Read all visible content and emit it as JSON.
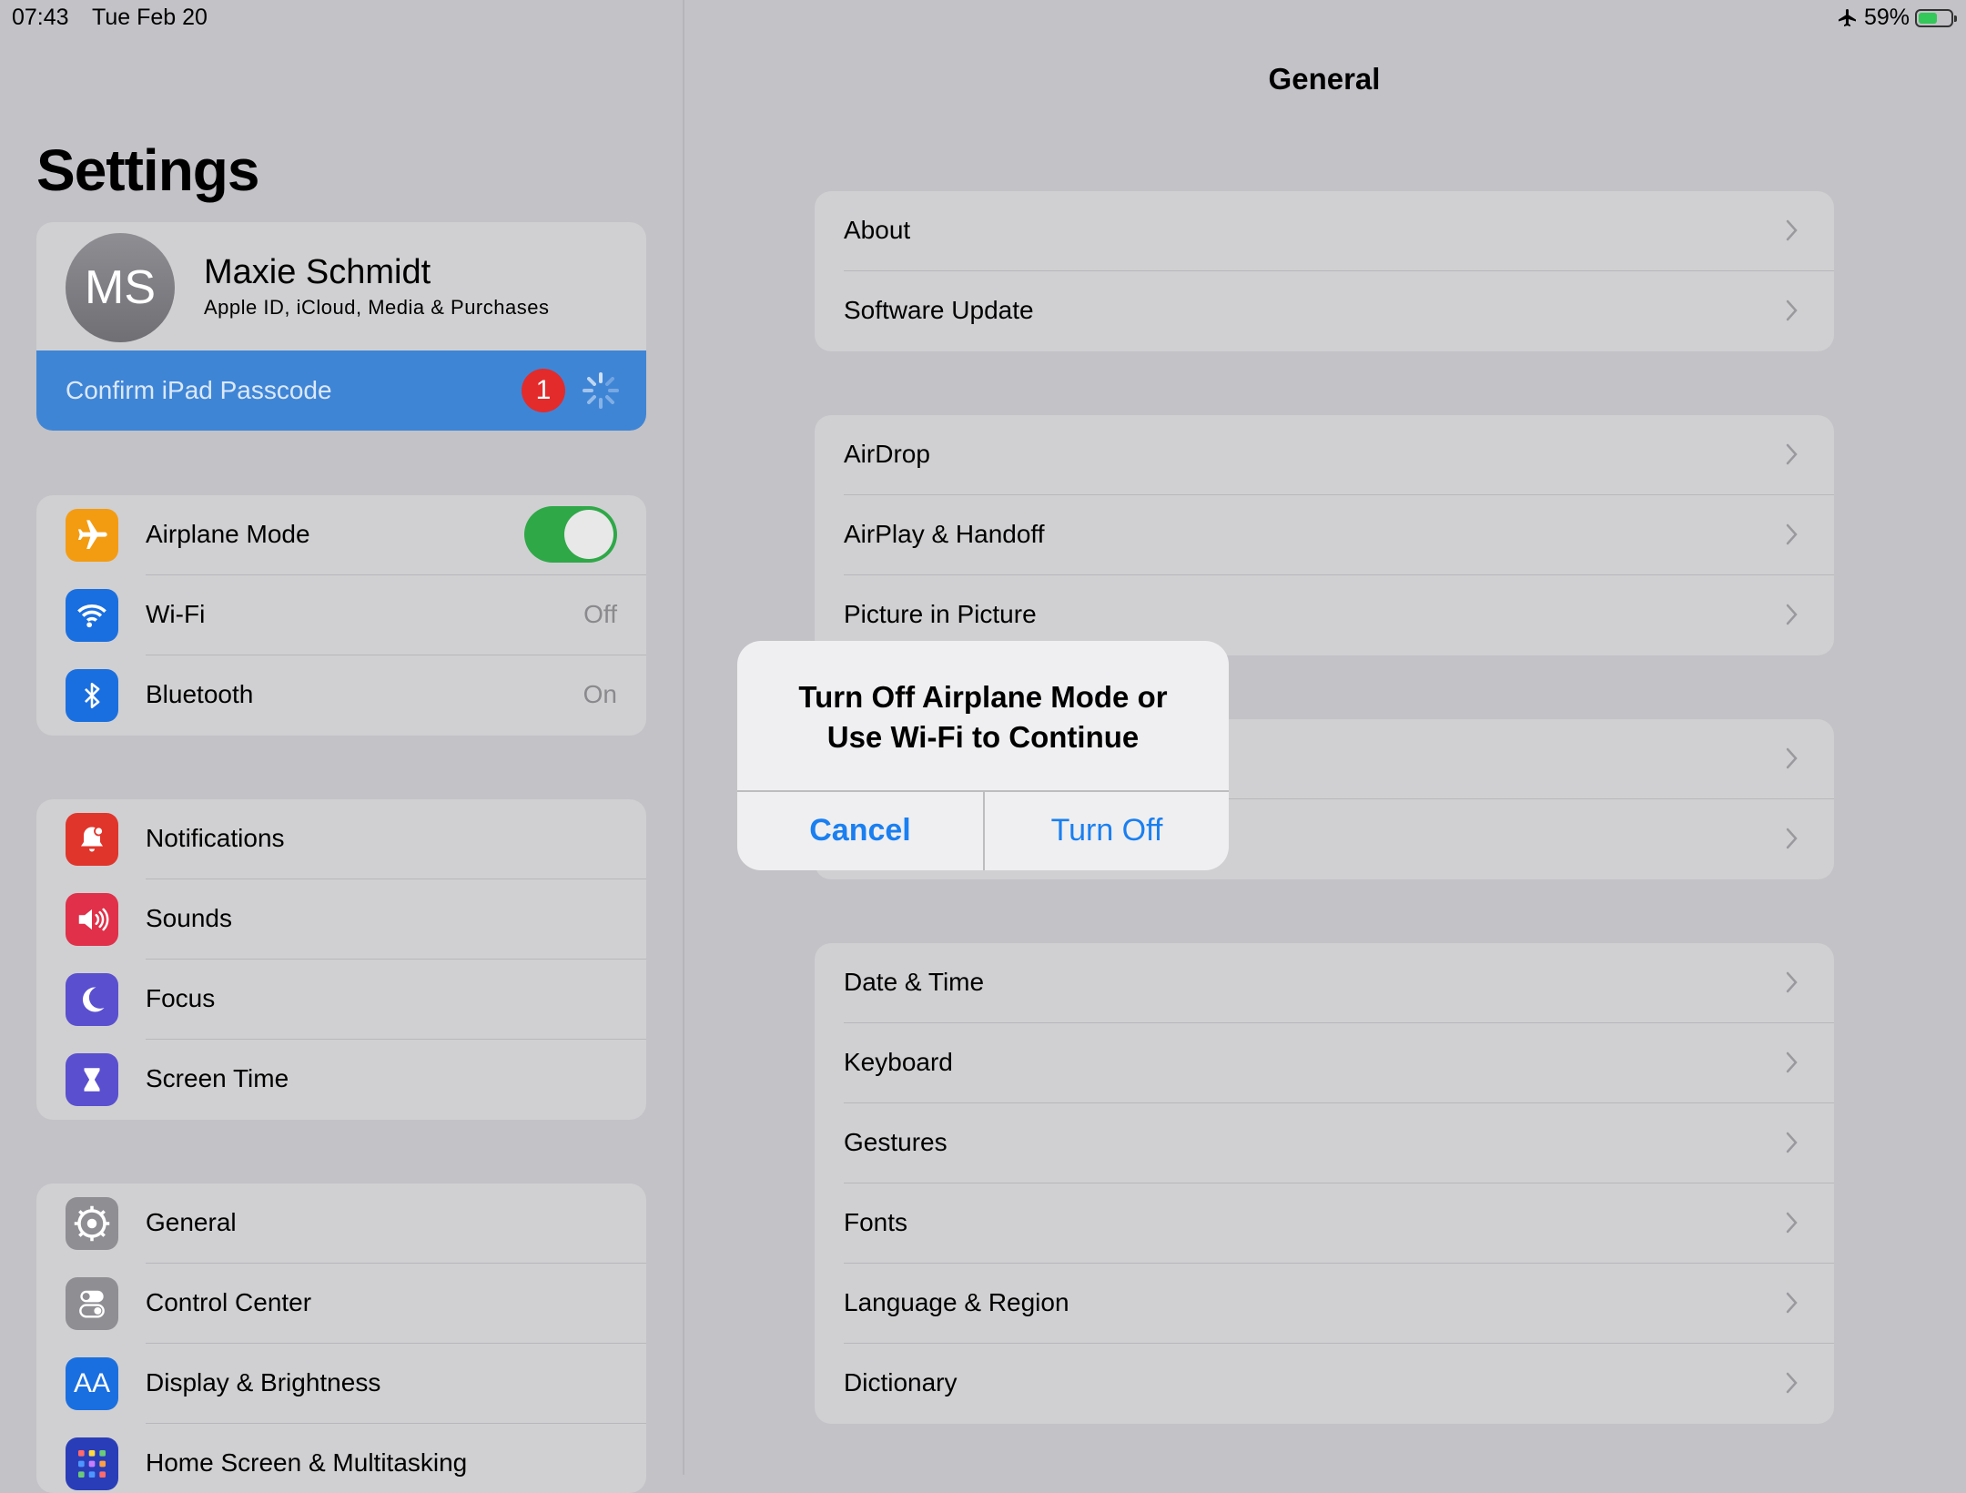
{
  "status_bar": {
    "time": "07:43",
    "date": "Tue Feb 20",
    "battery": "59%"
  },
  "sidebar": {
    "title": "Settings",
    "profile": {
      "initials": "MS",
      "name": "Maxie Schmidt",
      "subtitle": "Apple ID, iCloud, Media & Purchases"
    },
    "passcode": {
      "label": "Confirm iPad Passcode",
      "badge": "1"
    },
    "group1": [
      {
        "label": "Airplane Mode",
        "icon": "airplane-icon",
        "color": "#f39c12",
        "toggle": true
      },
      {
        "label": "Wi-Fi",
        "icon": "wifi-icon",
        "color": "#1a6fe0",
        "value": "Off"
      },
      {
        "label": "Bluetooth",
        "icon": "bluetooth-icon",
        "color": "#1a6fe0",
        "value": "On"
      }
    ],
    "group2": [
      {
        "label": "Notifications",
        "icon": "bell-icon",
        "color": "#e0352b"
      },
      {
        "label": "Sounds",
        "icon": "speaker-icon",
        "color": "#e0304a"
      },
      {
        "label": "Focus",
        "icon": "moon-icon",
        "color": "#5a4fcf"
      },
      {
        "label": "Screen Time",
        "icon": "hourglass-icon",
        "color": "#5a4fcf"
      }
    ],
    "group3": [
      {
        "label": "General",
        "icon": "gear-icon",
        "color": "#8e8e93"
      },
      {
        "label": "Control Center",
        "icon": "switches-icon",
        "color": "#8e8e93"
      },
      {
        "label": "Display & Brightness",
        "icon": "text-size-icon",
        "color": "#1a6fe0",
        "glyph": "AA"
      },
      {
        "label": "Home Screen & Multitasking",
        "icon": "app-grid-icon",
        "color": "#2a3db8"
      }
    ]
  },
  "detail": {
    "title": "General",
    "group1": [
      "About",
      "Software Update"
    ],
    "group2": [
      "AirDrop",
      "AirPlay & Handoff",
      "Picture in Picture"
    ],
    "group3": [
      "",
      ""
    ],
    "group4": [
      "Date & Time",
      "Keyboard",
      "Gestures",
      "Fonts",
      "Language & Region",
      "Dictionary"
    ]
  },
  "alert": {
    "title_line1": "Turn Off Airplane Mode or",
    "title_line2": "Use Wi-Fi to Continue",
    "cancel": "Cancel",
    "confirm": "Turn Off"
  }
}
